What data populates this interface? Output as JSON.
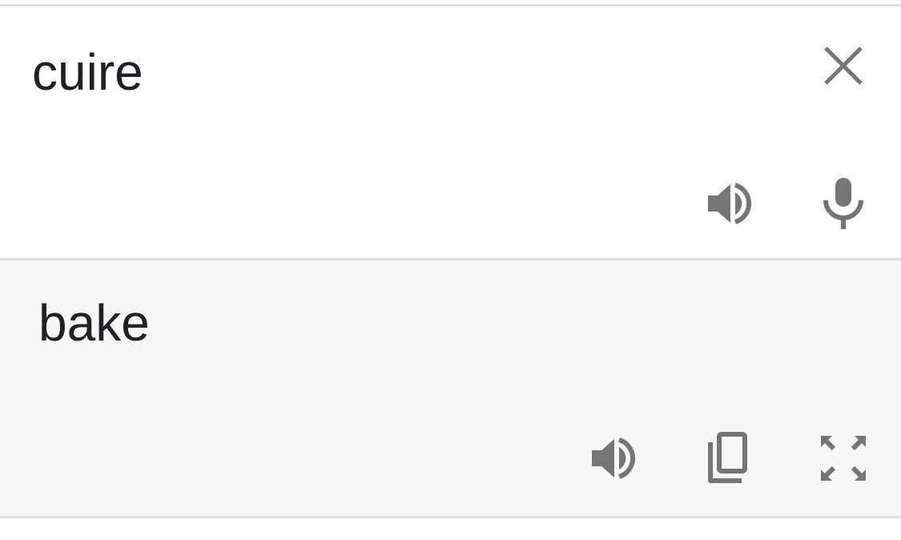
{
  "source": {
    "text": "cuire",
    "icons": {
      "clear": "close-icon",
      "listen": "volume-up-icon",
      "voice_input": "microphone-icon"
    }
  },
  "result": {
    "text": "bake",
    "icons": {
      "listen": "volume-up-icon",
      "copy": "copy-icon",
      "fullscreen": "fullscreen-icon"
    }
  },
  "colors": {
    "text": "#202124",
    "icon": "#757575",
    "divider": "#e0e0e0",
    "result_background": "#f7f7f7"
  }
}
